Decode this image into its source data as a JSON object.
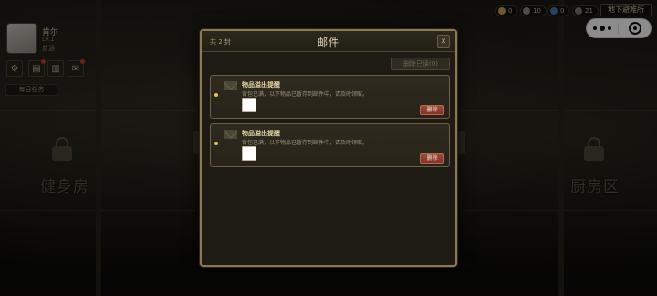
{
  "player": {
    "name": "肯尔",
    "level": "LV.1",
    "status": "普通"
  },
  "toolbar": {
    "gear_icon": "gear-icon",
    "tasks_icon": "clipboard-icon",
    "book_icon": "book-icon",
    "mail_icon": "mail-icon",
    "daily_task_label": "每日任务"
  },
  "resources": [
    {
      "name": "coin",
      "value": "0",
      "color": "#c8a14a"
    },
    {
      "name": "gem",
      "value": "10",
      "color": "#8a8a8a"
    },
    {
      "name": "energy",
      "value": "0",
      "color": "#4a76b8"
    },
    {
      "name": "ticket",
      "value": "21",
      "color": "#7a7a6a"
    }
  ],
  "shelter_label": "地下避难所",
  "rooms": {
    "left": "健身房",
    "right": "厨房区"
  },
  "mail_dialog": {
    "count": "共 2 封",
    "title": "邮件",
    "close_label": "x",
    "delete_read_label": "删除已读(0)",
    "items": [
      {
        "subject": "物品溢出提醒",
        "body": "背包已满，以下物品已暂存到邮件中，请及时领取。",
        "delete_label": "删除"
      },
      {
        "subject": "物品溢出提醒",
        "body": "背包已满，以下物品已暂存到邮件中，请及时领取。",
        "delete_label": "删除"
      }
    ]
  }
}
